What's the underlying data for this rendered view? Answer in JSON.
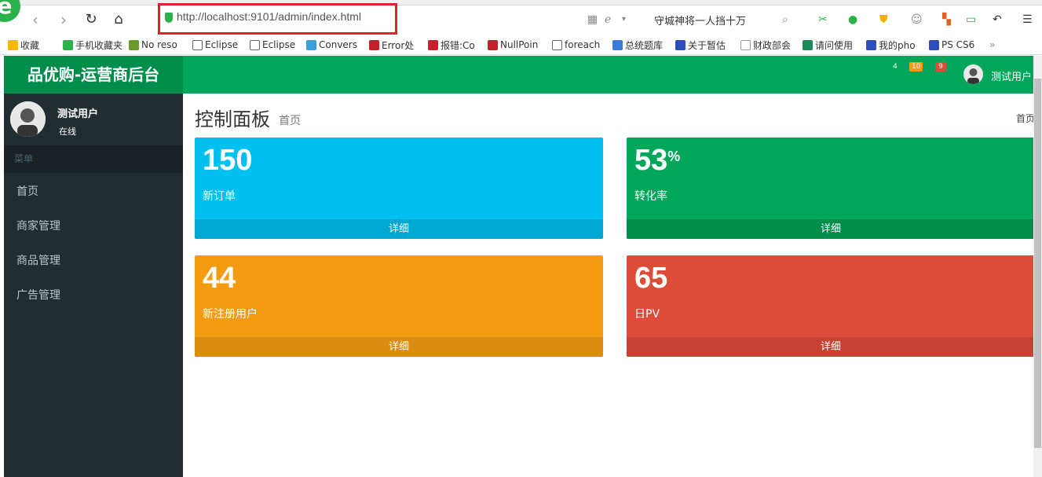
{
  "browser": {
    "url": "http://localhost:9101/admin/index.html",
    "search_text": "守城神将一人挡十万",
    "bookmarks": [
      "收藏",
      "手机收藏夹",
      "No reso",
      "Eclipse",
      "Eclipse",
      "Convers",
      "Error处",
      "报错:Co",
      "NullPoin",
      "foreach",
      "总统题库",
      "关于暂估",
      "财政部会",
      "请问使用",
      "我的pho",
      "PS CS6",
      "»"
    ]
  },
  "header": {
    "logo": "品优购-运营商后台",
    "badges": [
      {
        "count": "4",
        "color": "#00a65a"
      },
      {
        "count": "10",
        "color": "#f39c12"
      },
      {
        "count": "9",
        "color": "#dd4b39"
      }
    ],
    "user_name": "测试用户"
  },
  "sidebar": {
    "user_name": "测试用户",
    "status": "在线",
    "menu_header": "菜单",
    "items": [
      {
        "label": "首页"
      },
      {
        "label": "商家管理"
      },
      {
        "label": "商品管理"
      },
      {
        "label": "广告管理"
      }
    ]
  },
  "content": {
    "title": "控制面板",
    "subtitle": "首页",
    "breadcrumb": "首页"
  },
  "stats": [
    {
      "value": "150",
      "suffix": "",
      "label": "新订单",
      "more": "详细",
      "color": "#00c0ef",
      "footer_color": "#00a7d0"
    },
    {
      "value": "53",
      "suffix": "%",
      "label": "转化率",
      "more": "详细",
      "color": "#00a65a",
      "footer_color": "#008d4c"
    },
    {
      "value": "44",
      "suffix": "",
      "label": "新注册用户",
      "more": "详细",
      "color": "#f39c12",
      "footer_color": "#da8c10"
    },
    {
      "value": "65",
      "suffix": "",
      "label": "日PV",
      "more": "详细",
      "color": "#dd4b39",
      "footer_color": "#c64333"
    }
  ]
}
